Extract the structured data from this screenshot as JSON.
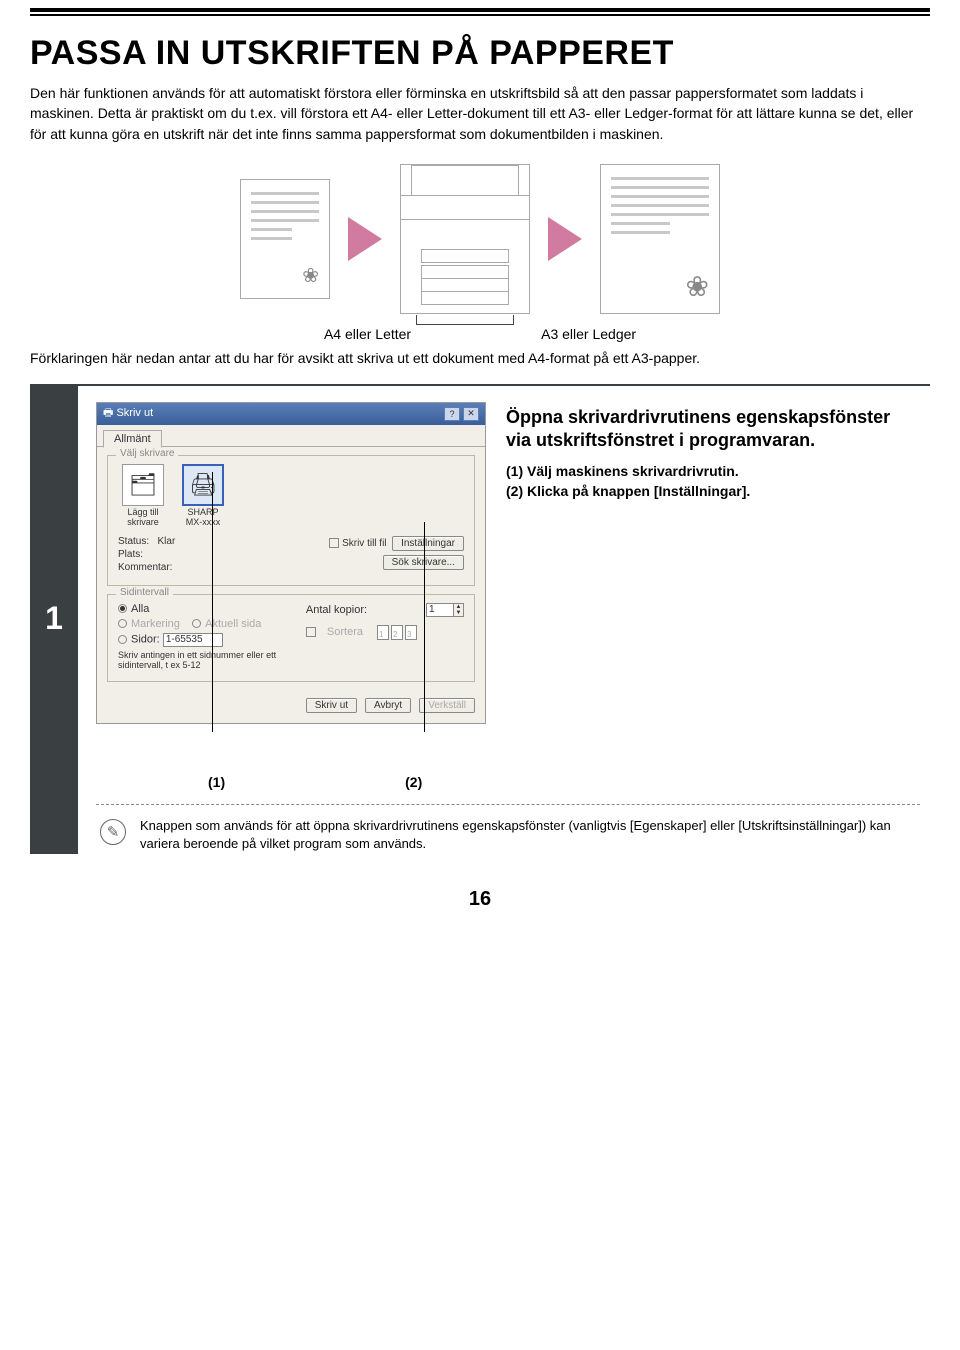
{
  "title": "PASSA IN UTSKRIFTEN PÅ PAPPERET",
  "intro": "Den här funktionen används för att automatiskt förstora eller förminska en utskriftsbild så att den passar pappersformatet som laddats i maskinen.\nDetta är praktiskt om du t.ex. vill förstora ett A4- eller Letter-dokument till ett A3- eller Ledger-format för att lättare kunna se det, eller för att kunna göra en utskrift när det inte finns samma pappersformat som dokumentbilden i maskinen.",
  "illustration": {
    "left_caption": "A4 eller Letter",
    "right_caption": "A3 eller Ledger"
  },
  "explanation": "Förklaringen här nedan antar att du har för avsikt att skriva ut ett dokument med A4-format på ett A3-papper.",
  "step": {
    "number": "1",
    "heading": "Öppna skrivardrivrutinens egenskapsfönster via utskriftsfönstret i programvaran.",
    "line1": "(1)  Välj maskinens skrivardrivrutin.",
    "line2": "(2)  Klicka på knappen [Inställningar].",
    "marker1": "(1)",
    "marker2": "(2)"
  },
  "dialog": {
    "title": "Skriv ut",
    "tab": "Allmänt",
    "group_printer": "Välj skrivare",
    "add_printer_line1": "Lägg till",
    "add_printer_line2": "skrivare",
    "selected_printer_line1": "SHARP",
    "selected_printer_line2": "MX-xxxx",
    "status_label": "Status:",
    "status_value": "Klar",
    "location_label": "Plats:",
    "comment_label": "Kommentar:",
    "print_to_file": "Skriv till fil",
    "settings_btn": "Inställningar",
    "find_printer_btn": "Sök skrivare...",
    "group_range": "Sidintervall",
    "range_all": "Alla",
    "range_selection": "Markering",
    "range_current": "Aktuell sida",
    "range_pages": "Sidor:",
    "range_pages_value": "1-65535",
    "range_hint": "Skriv antingen in ett sidnummer eller ett sidintervall, t ex 5-12",
    "copies_label": "Antal kopior:",
    "copies_value": "1",
    "collate": "Sortera",
    "btn_print": "Skriv ut",
    "btn_cancel": "Avbryt",
    "btn_apply": "Verkställ"
  },
  "note": "Knappen som används för att öppna skrivardrivrutinens egenskapsfönster (vanligtvis [Egenskaper] eller [Utskriftsinställningar]) kan variera beroende på vilket program som används.",
  "page_number": "16"
}
